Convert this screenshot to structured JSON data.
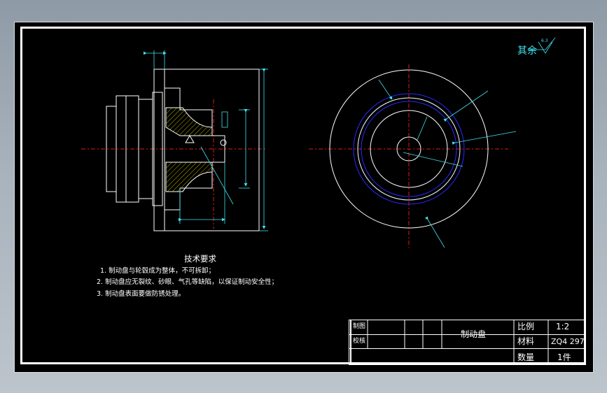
{
  "surface_finish": {
    "label": "其余",
    "value": "6.3"
  },
  "tech_requirements": {
    "title": "技术要求",
    "items": [
      "1. 制动盘与轮毂成为整体，不可拆卸；",
      "2. 制动盘应无裂纹、砂眼、气孔等缺陷，以保证制动安全性；",
      "3. 制动盘表面要做防锈处理。"
    ]
  },
  "title_block": {
    "draw_label": "制图",
    "check_label": "校核",
    "part_name": "制动盘",
    "scale_label": "比例",
    "scale_value": "1:2",
    "material_label": "材料",
    "material_value": "ZQ4 297",
    "quantity_label": "数量",
    "quantity_value": "1件"
  },
  "colors": {
    "background": "#000000",
    "line": "#ffffff",
    "dimension": "#3fe3ef",
    "centerline": "#e01a1a",
    "hatch": "#e0e000",
    "hidden_circle": "#2a2aff"
  }
}
